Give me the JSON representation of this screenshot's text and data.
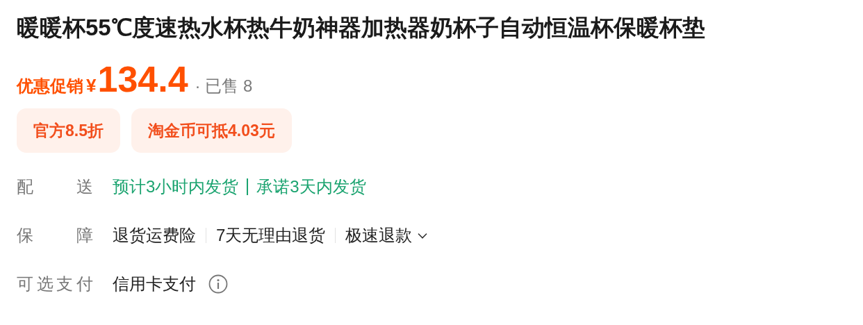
{
  "title": "暖暖杯55℃度速热水杯热牛奶神器加热器奶杯子自动恒温杯保暖杯垫",
  "price": {
    "promo_label": "优惠促销",
    "currency": "¥",
    "amount": "134.4",
    "sold": "· 已售 8"
  },
  "coupons": [
    "官方8.5折",
    "淘金币可抵4.03元"
  ],
  "delivery": {
    "label": "配 送",
    "items": [
      "预计3小时内发货",
      "承诺3天内发货"
    ]
  },
  "guarantee": {
    "label": "保 障",
    "items": [
      {
        "text": "退货运费险",
        "has_menu": false
      },
      {
        "text": "7天无理由退货",
        "has_menu": false
      },
      {
        "text": "极速退款",
        "has_menu": true
      }
    ]
  },
  "payment": {
    "label": "可选支付",
    "value": "信用卡支付"
  }
}
